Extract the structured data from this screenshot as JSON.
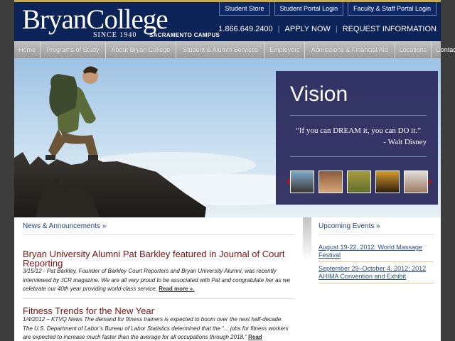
{
  "header": {
    "logo": "BryanCollege",
    "since": "SINCE 1940",
    "campus": "SACRAMENTO CAMPUS",
    "top_links": [
      "Student Store",
      "Student Portal Login",
      "Faculty & Staff Portal Login"
    ],
    "phone": "1.866.649.2400",
    "apply": "APPLY NOW",
    "request": "REQUEST INFORMATION"
  },
  "nav": [
    "Home",
    "Programs of Study",
    "About Bryan College",
    "Student & Alumni Services",
    "Employers",
    "Admissions & Financial Aid",
    "Locations",
    "Contact Us"
  ],
  "hero": {
    "title": "Vision",
    "quote": "“If you can DREAM it, you can DO it.”",
    "attribution": "- Walt Disney"
  },
  "news": {
    "heading": "News & Announcements »",
    "articles": [
      {
        "title": "Bryan University Alumni Pat Barkley featured in Journal of Court Reporting",
        "body": "3/15/12 - Pat Barkley, Founder of Barkley Court Reporters and Bryan University Alumni, was recently interviewed by JCR magazine. We are all very proud to be associated with Pat and congratulate her as we celebrate our 40th year providing world-class service,",
        "read_more": "Read more »."
      },
      {
        "title": "Fitness Trends for the New Year",
        "body": "1/4/2012 – KTVQ News The demand for fitness trainers is expected to boom over the next half-decade. The U.S. Department of Labor’s Bureau of Labor Statistics determined that the “... jobs for fitness workers are expected to increase much faster than the average for all occupations through 2018.”",
        "read_more": "Read"
      }
    ]
  },
  "events": {
    "heading": "Upcoming Events »",
    "items": [
      "August 19-22, 2012: World Massage Festival",
      "September 29–October 4, 2012: 2012 AHIMA Convention and Exhibit"
    ]
  },
  "colors": {
    "header_bg": "#0c2358",
    "gold_accent": "#c7a84a",
    "vision_bg": "#2a2a5c",
    "article_title": "#7d1313",
    "link_blue": "#1f3f7a"
  }
}
